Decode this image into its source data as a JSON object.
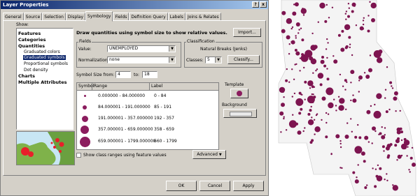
{
  "window": {
    "title": "Layer Properties",
    "help_label": "?",
    "close_label": "x"
  },
  "tabs": [
    "General",
    "Source",
    "Selection",
    "Display",
    "Symbology",
    "Fields",
    "Definition Query",
    "Labels",
    "Joins & Relates"
  ],
  "active_tab": "Symbology",
  "show": {
    "label": "Show:",
    "items": [
      {
        "label": "Features",
        "bold": true
      },
      {
        "label": "Categories",
        "bold": true
      },
      {
        "label": "Quantities",
        "bold": true
      },
      {
        "label": "Graduated colors",
        "bold": false
      },
      {
        "label": "Graduated symbols",
        "bold": false,
        "selected": true
      },
      {
        "label": "Proportional symbols",
        "bold": false
      },
      {
        "label": "Dot density",
        "bold": false
      },
      {
        "label": "Charts",
        "bold": true
      },
      {
        "label": "Multiple Attributes",
        "bold": true
      }
    ]
  },
  "symbology": {
    "heading": "Draw quantities using symbol size to show relative values.",
    "import_label": "Import...",
    "fields_label": "Fields",
    "value_label": "Value:",
    "value": "UNEMPLOYED",
    "normalization_label": "Normalization:",
    "normalization": "none",
    "classification_label": "Classification",
    "method": "Natural Breaks (Jenks)",
    "classes_label": "Classes:",
    "classes_value": "5",
    "classify_label": "Classify...",
    "size_from_label": "Symbol Size from:",
    "size_from": "4",
    "size_to_label": "to:",
    "size_to": "18",
    "template_label": "Template",
    "background_label": "Background",
    "table_headers": [
      "Symbol",
      "Range",
      "Label"
    ],
    "rows": [
      {
        "range": "0.000000 - 84.000000",
        "label": "0 - 84",
        "color": "#8b1c5e"
      },
      {
        "range": "84.000001 - 191.000000",
        "label": "85 - 191",
        "color": "#8b1c5e"
      },
      {
        "range": "191.000001 - 357.000000",
        "label": "192 - 357",
        "color": "#8b1c5e"
      },
      {
        "range": "357.000001 - 659.000000",
        "label": "358 - 659",
        "color": "#8b1c5e"
      },
      {
        "range": "659.000001 - 1799.000000",
        "label": "660 - 1799",
        "color": "#8b1c5e"
      }
    ],
    "show_class_ranges_label": "Show class ranges using feature values",
    "advanced_label": "Advanced"
  },
  "buttons": {
    "ok": "OK",
    "cancel": "Cancel",
    "apply": "Apply"
  },
  "colors": {
    "symbol": "#8b1c5e",
    "title_bar": "#0a246a",
    "dialog": "#d4d0c8"
  }
}
